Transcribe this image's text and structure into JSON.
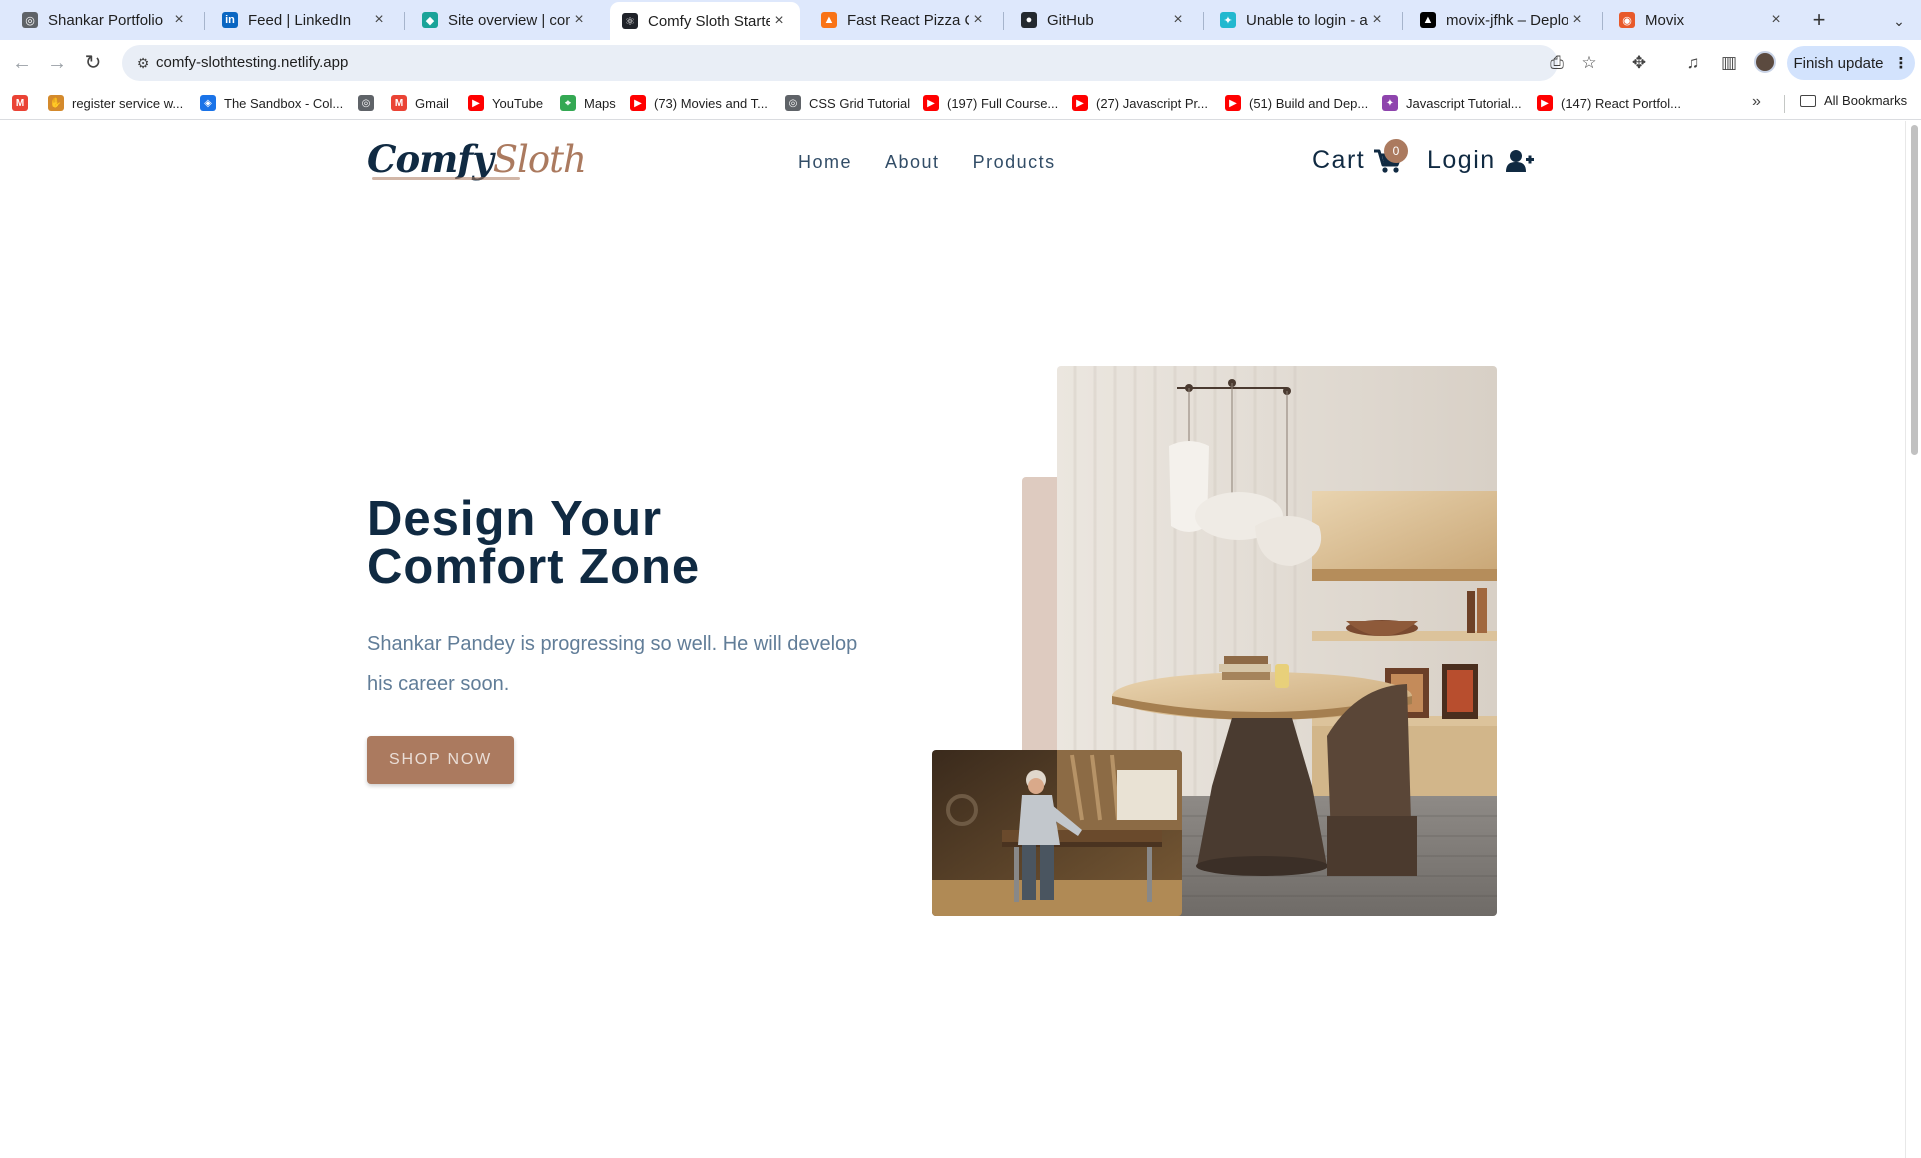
{
  "browser": {
    "tabs": [
      {
        "title": "Shankar Portfolio",
        "icon": "globe-icon",
        "color": "#5f6368"
      },
      {
        "title": "Feed | LinkedIn",
        "icon": "linkedin-icon",
        "color": "#0a66c2"
      },
      {
        "title": "Site overview | comfy-",
        "icon": "netlify-icon",
        "color": "#1aa399"
      },
      {
        "title": "Comfy Sloth Starter",
        "icon": "react-icon",
        "color": "#20232a",
        "active": true
      },
      {
        "title": "Fast React Pizza Co.",
        "icon": "pizza-icon",
        "color": "#f97316"
      },
      {
        "title": "GitHub",
        "icon": "github-icon",
        "color": "#24292f"
      },
      {
        "title": "Unable to login - authe",
        "icon": "sparkle-icon",
        "color": "#22b8cf"
      },
      {
        "title": "movix-jfhk – Deployme",
        "icon": "vercel-icon",
        "color": "#000000"
      },
      {
        "title": "Movix",
        "icon": "movix-icon",
        "color": "#e85a2b"
      }
    ],
    "url": "comfy-slothtesting.netlify.app",
    "finish_update": "Finish update",
    "bookmarks": [
      {
        "label": "",
        "icon": "gmail-icon",
        "color": "#ea4335"
      },
      {
        "label": "register service w...",
        "icon": "hand-icon",
        "color": "#d48a2c"
      },
      {
        "label": "The Sandbox - Col...",
        "icon": "sandbox-icon",
        "color": "#1a73e8"
      },
      {
        "label": "",
        "icon": "globe-icon",
        "color": "#5f6368"
      },
      {
        "label": "Gmail",
        "icon": "gmail-icon",
        "color": "#ea4335"
      },
      {
        "label": "YouTube",
        "icon": "youtube-icon",
        "color": "#ff0000"
      },
      {
        "label": "Maps",
        "icon": "maps-icon",
        "color": "#34a853"
      },
      {
        "label": "(73) Movies and T...",
        "icon": "youtube-icon",
        "color": "#ff0000"
      },
      {
        "label": "CSS Grid Tutorial",
        "icon": "globe-icon",
        "color": "#5f6368"
      },
      {
        "label": "(197) Full Course...",
        "icon": "youtube-icon",
        "color": "#ff0000"
      },
      {
        "label": "(27) Javascript Pr...",
        "icon": "youtube-icon",
        "color": "#ff0000"
      },
      {
        "label": "(51) Build and Dep...",
        "icon": "youtube-icon",
        "color": "#ff0000"
      },
      {
        "label": "Javascript Tutorial...",
        "icon": "bulb-icon",
        "color": "#8e44ad"
      },
      {
        "label": "(147) React Portfol...",
        "icon": "youtube-icon",
        "color": "#ff0000"
      }
    ],
    "all_bookmarks": "All Bookmarks"
  },
  "site": {
    "logo": {
      "part1": "Comfy",
      "part2": "Sloth"
    },
    "nav": [
      "Home",
      "About",
      "Products"
    ],
    "cart": {
      "label": "Cart",
      "count": "0"
    },
    "login": {
      "label": "Login"
    },
    "hero": {
      "title_line1": "Design Your",
      "title_line2": "Comfort Zone",
      "description": "Shankar Pandey is progressing so well. He will develop his career soon.",
      "button": "SHOP NOW"
    },
    "colors": {
      "primary": "#ab7a5f",
      "dark": "#102a42",
      "text": "#617d98",
      "accent_light": "#decbc0"
    }
  }
}
